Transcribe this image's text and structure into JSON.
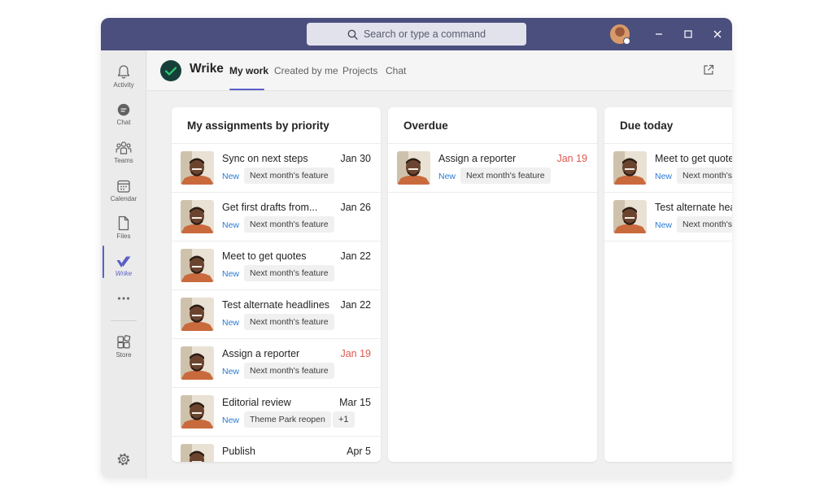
{
  "search": {
    "placeholder": "Search or type a command"
  },
  "rail": {
    "items": [
      {
        "label": "Activity"
      },
      {
        "label": "Chat"
      },
      {
        "label": "Teams"
      },
      {
        "label": "Calendar"
      },
      {
        "label": "Files"
      },
      {
        "label": "Wrike"
      },
      {
        "label": "Store"
      }
    ]
  },
  "app": {
    "name": "Wrike",
    "tabs": [
      {
        "label": "My work"
      },
      {
        "label": "Created by me"
      },
      {
        "label": "Projects"
      },
      {
        "label": "Chat"
      }
    ]
  },
  "columns": [
    {
      "title": "My assignments by priority",
      "cards": [
        {
          "title": "Sync on next steps",
          "date": "Jan 30",
          "status": "New",
          "tag": "Next month's feature"
        },
        {
          "title": "Get first drafts from...",
          "date": "Jan 26",
          "status": "New",
          "tag": "Next month's feature"
        },
        {
          "title": "Meet to get quotes",
          "date": "Jan 22",
          "status": "New",
          "tag": "Next month's feature"
        },
        {
          "title": "Test alternate headlines",
          "date": "Jan 22",
          "status": "New",
          "tag": "Next month's feature"
        },
        {
          "title": "Assign a reporter",
          "date": "Jan 19",
          "status": "New",
          "tag": "Next month's feature"
        },
        {
          "title": "Editorial review",
          "date": "Mar 15",
          "status": "New",
          "tag": "Theme Park reopen",
          "extra": "+1"
        },
        {
          "title": "Publish",
          "date": "Apr 5"
        }
      ]
    },
    {
      "title": "Overdue",
      "cards": [
        {
          "title": "Assign a reporter",
          "date": "Jan 19",
          "status": "New",
          "tag": "Next month's feature"
        }
      ]
    },
    {
      "title": "Due today",
      "cards": [
        {
          "title": "Meet to get quotes",
          "status": "New",
          "tag": "Next month's feature"
        },
        {
          "title": "Test alternate headlines",
          "status": "New",
          "tag": "Next month's feature"
        }
      ]
    }
  ],
  "colors": {
    "titlebar": "#4b4f7d",
    "accent": "#5b5fc7",
    "status_new": "#2a79d4",
    "overdue_date": "#e0584e",
    "wrike_logo": "#173f3a",
    "wrike_check": "#2ecc71"
  },
  "icons": {
    "rail": [
      "bell-icon",
      "chat-icon",
      "teams-icon",
      "calendar-icon",
      "file-icon",
      "wrike-icon",
      "more-icon",
      "store-icon",
      "settings-icon"
    ],
    "titlebar": [
      "search-icon",
      "minimize-icon",
      "maximize-icon",
      "close-icon"
    ],
    "header": [
      "popout-icon"
    ]
  }
}
